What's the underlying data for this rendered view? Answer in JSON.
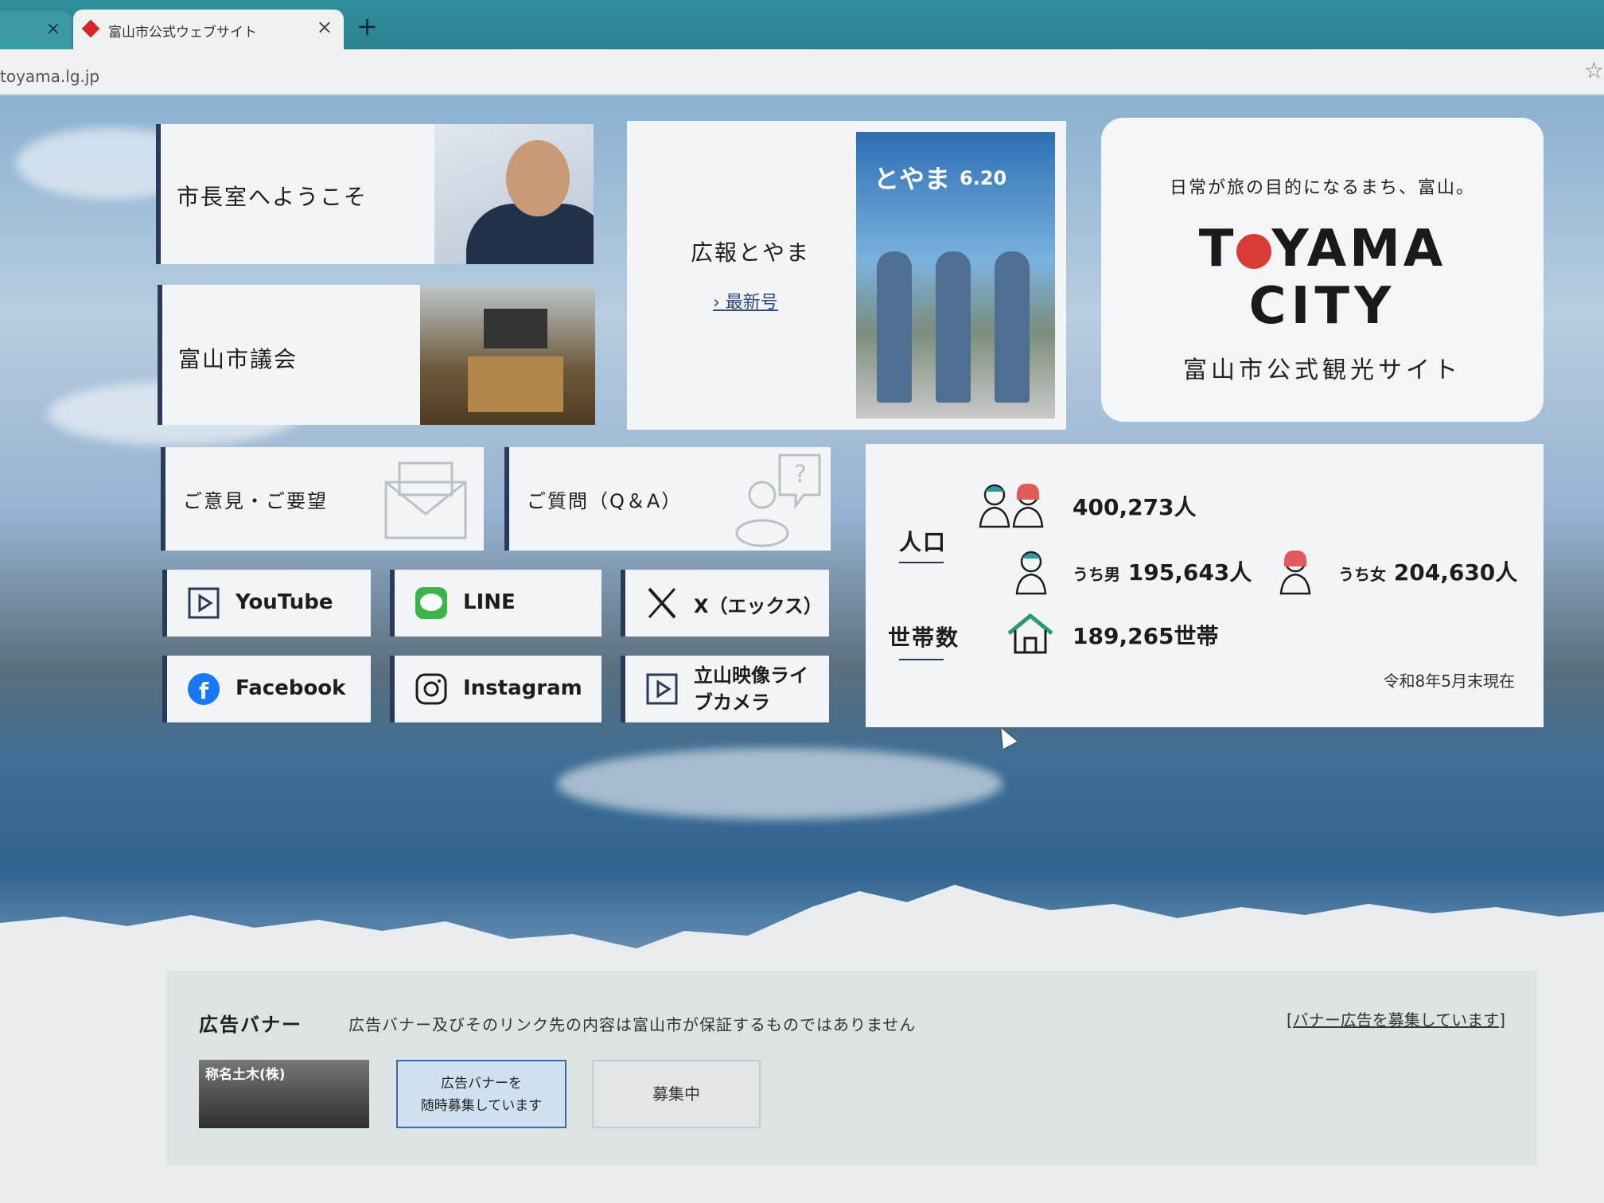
{
  "browser": {
    "tab_title": "富山市公式ウェブサイト",
    "close_glyph": "×",
    "new_tab_glyph": "+",
    "url": "toyama.lg.jp"
  },
  "tiles": {
    "mayor": "市長室へようこそ",
    "council": "富山市議会",
    "koho_title": "広報とやま",
    "koho_latest": "最新号",
    "koho_cover_title": "とやま",
    "koho_cover_date": "6.20",
    "opinion": "ご意見・ご要望",
    "qa": "ご質問（Q＆A）"
  },
  "tourism": {
    "tagline": "日常が旅の目的になるまち、富山。",
    "logo_line1a": "T",
    "logo_line1b": "YAMA",
    "logo_line2": "CITY",
    "subtitle": "富山市公式観光サイト"
  },
  "sns": {
    "youtube": "YouTube",
    "line": "LINE",
    "x": "X（エックス）",
    "facebook": "Facebook",
    "instagram": "Instagram",
    "tateyama_line1": "立山映像ライ",
    "tateyama_line2": "ブカメラ"
  },
  "stats": {
    "population_label": "人口",
    "population_total": "400,273人",
    "male_label": "うち男",
    "male_value": "195,643人",
    "female_label": "うち女",
    "female_value": "204,630人",
    "households_label": "世帯数",
    "households_value": "189,265世帯",
    "as_of": "令和8年5月末現在"
  },
  "ads": {
    "heading": "広告バナー",
    "disclaimer": "広告バナー及びそのリンク先の内容は富山市が保証するものではありません",
    "recruit_link": "[バナー広告を募集しています]",
    "banner1": "称名土木(株)",
    "banner2_line1": "広告バナーを",
    "banner2_line2": "随時募集しています",
    "banner3": "募集中"
  },
  "colors": {
    "accent_navy": "#2a3a5a",
    "logo_red": "#d83a34",
    "line_green": "#3bb54a",
    "facebook_blue": "#1877f2"
  }
}
